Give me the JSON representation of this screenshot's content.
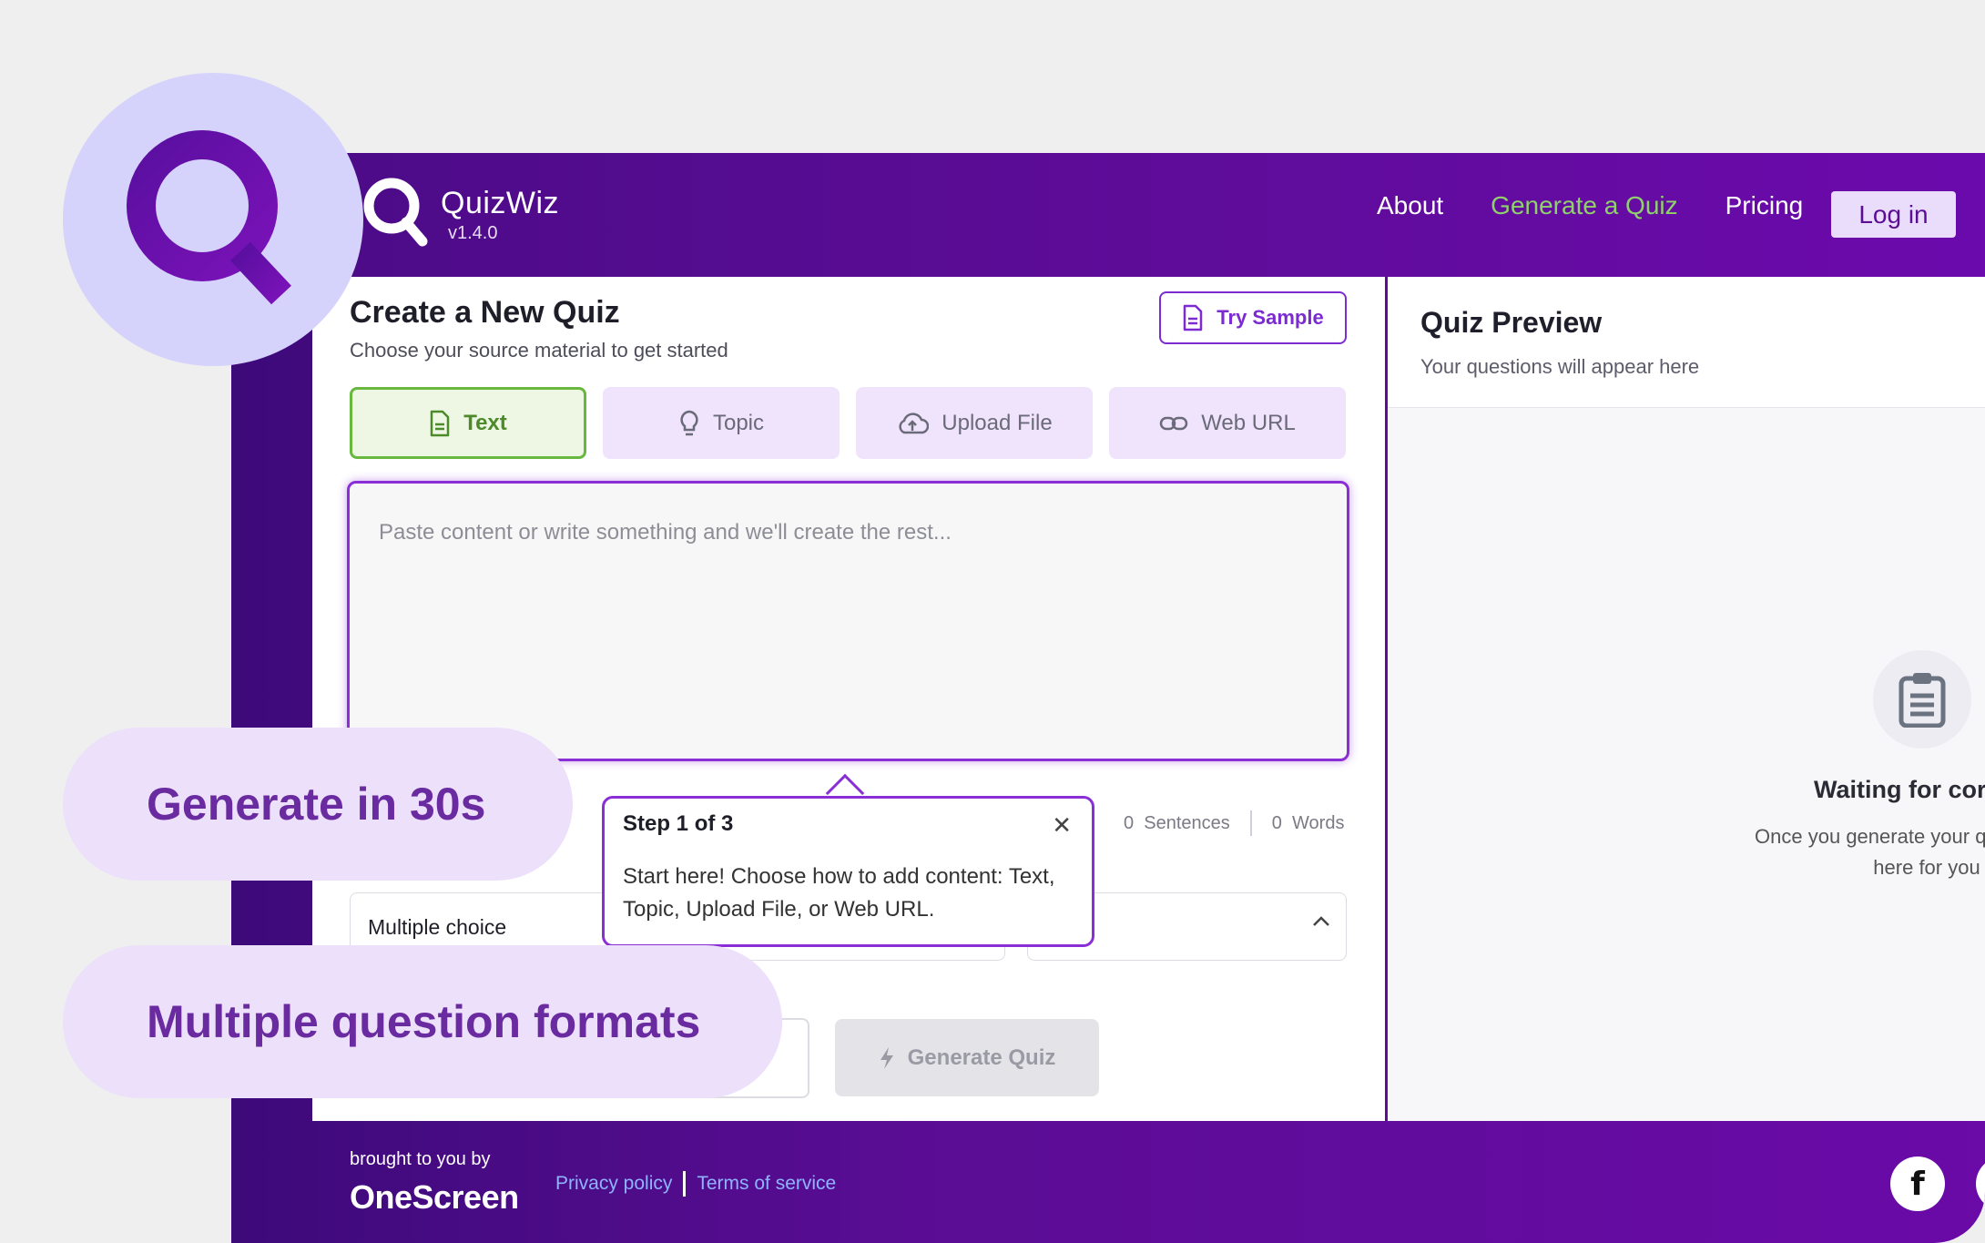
{
  "brand": {
    "name": "QuizWiz",
    "version": "v1.4.0"
  },
  "nav": {
    "links": [
      "About",
      "Generate a Quiz",
      "Pricing"
    ],
    "active_index": 1,
    "login_label": "Log in"
  },
  "create": {
    "title": "Create a New Quiz",
    "subtitle": "Choose your source material to get started",
    "try_sample": "Try Sample",
    "tabs": [
      {
        "label": "Text",
        "icon": "document-icon",
        "active": true
      },
      {
        "label": "Topic",
        "icon": "lightbulb-icon",
        "active": false
      },
      {
        "label": "Upload File",
        "icon": "cloud-upload-icon",
        "active": false
      },
      {
        "label": "Web URL",
        "icon": "link-icon",
        "active": false
      }
    ],
    "textarea_placeholder": "Paste content or write something and we'll create the rest...",
    "counts": {
      "sentences": "0",
      "sentences_label": "Sentences",
      "words": "0",
      "words_label": "Words"
    },
    "question_type": "Multiple choice",
    "generate_label": "Generate Quiz"
  },
  "tooltip": {
    "title": "Step 1 of 3",
    "body": "Start here! Choose how to add content: Text, Topic, Upload File, or Web URL."
  },
  "preview": {
    "title": "Quiz Preview",
    "subtitle": "Your questions will appear here",
    "waiting_title": "Waiting for cor",
    "waiting_text": "Once you generate your qu will appear here for you"
  },
  "footer": {
    "brought_by": "brought to you by",
    "company": "OneScreen",
    "privacy": "Privacy policy",
    "terms": "Terms of service"
  },
  "overlays": {
    "pill_1": "Generate in 30s",
    "pill_2": "Multiple question formats"
  },
  "colors": {
    "brand_purple": "#5b0d95",
    "accent_green": "#68b83f",
    "pill_text": "#6a2aa0"
  }
}
